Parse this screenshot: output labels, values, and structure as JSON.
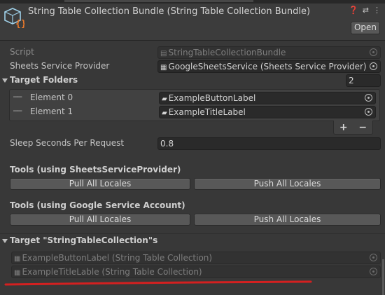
{
  "header": {
    "title": "String Table Collection Bundle (String Table Collection Bundle)",
    "open_label": "Open",
    "icons": [
      "help-icon",
      "preset-icon",
      "menu-icon"
    ]
  },
  "fields": {
    "script": {
      "label": "Script",
      "value": "StringTableCollectionBundle"
    },
    "sheets_provider": {
      "label": "Sheets Service Provider",
      "value": "GoogleSheetsService (Sheets Service Provider)"
    },
    "target_folders": {
      "label": "Target Folders",
      "count": "2",
      "elements": [
        {
          "label": "Element 0",
          "value": "ExampleButtonLabel"
        },
        {
          "label": "Element 1",
          "value": "ExampleTitleLabel"
        }
      ],
      "add_label": "+",
      "remove_label": "−"
    },
    "sleep": {
      "label": "Sleep Seconds Per Request",
      "value": "0.8"
    }
  },
  "tools_provider": {
    "heading": "Tools (using SheetsServiceProvider)",
    "pull_label": "Pull All Locales",
    "push_label": "Push All Locales"
  },
  "tools_account": {
    "heading": "Tools (using Google Service Account)",
    "pull_label": "Pull All Locales",
    "push_label": "Push All Locales"
  },
  "target_collections": {
    "heading": "Target \"StringTableCollection\"s",
    "items": [
      "ExampleButtonLabel (String Table Collection)",
      "ExampleTitleLable (String Table Collection)"
    ]
  },
  "colors": {
    "background": "#383838",
    "field_bg": "#2a2a2a",
    "button_bg": "#585858",
    "annotation_red": "#d42020"
  }
}
